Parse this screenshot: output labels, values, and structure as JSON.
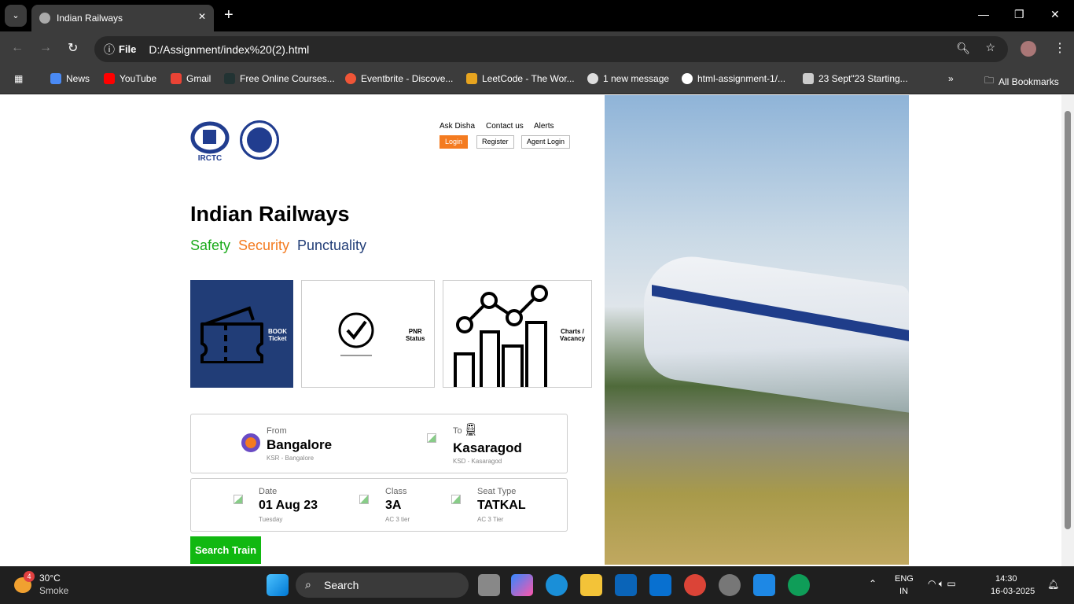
{
  "browser": {
    "tab_title": "Indian Railways",
    "url_scheme": "File",
    "url": "D:/Assignment/index%20(2).html",
    "bookmarks": [
      "News",
      "YouTube",
      "Gmail",
      "Free Online Courses...",
      "Eventbrite - Discove...",
      "LeetCode - The Wor...",
      "1 new message",
      "html-assignment-1/...",
      "23 Sept\"23 Starting..."
    ],
    "all_bookmarks": "All Bookmarks"
  },
  "header": {
    "logo_text": "IRCTC",
    "links": [
      "Ask Disha",
      "Contact us",
      "Alerts"
    ],
    "login": "Login",
    "register": "Register",
    "agent_login": "Agent Login"
  },
  "hero": {
    "title": "Indian Railways",
    "taglines": [
      {
        "text": "Safety",
        "color": "#1aaa1a"
      },
      {
        "text": "Security",
        "color": "#f47b20"
      },
      {
        "text": "Punctuality",
        "color": "#213d77"
      }
    ]
  },
  "cards": [
    {
      "line1": "BOOK",
      "line2": "Ticket",
      "icon": "ticket-icon"
    },
    {
      "line1": "PNR",
      "line2": "Status",
      "icon": "check-circle-icon"
    },
    {
      "line1": "Charts /",
      "line2": "Vacancy",
      "icon": "chart-icon"
    }
  ],
  "journey": {
    "from_label": "From",
    "from_value": "Bangalore",
    "from_sub": "KSR - Bangalore",
    "to_label": "To",
    "to_value": "Kasaragod",
    "to_sub": "KSD - Kasaragod"
  },
  "details": {
    "date_label": "Date",
    "date_value": "01 Aug 23",
    "date_sub": "Tuesday",
    "class_label": "Class",
    "class_value": "3A",
    "class_sub": "AC 3 tier",
    "seat_label": "Seat Type",
    "seat_value": "TATKAL",
    "seat_sub": "AC 3 Tier"
  },
  "search_button": "Search Train",
  "taskbar": {
    "weather_temp": "30°C",
    "weather_desc": "Smoke",
    "weather_badge": "4",
    "search": "Search",
    "lang1": "ENG",
    "lang2": "IN",
    "time": "14:30",
    "date": "16-03-2025"
  }
}
